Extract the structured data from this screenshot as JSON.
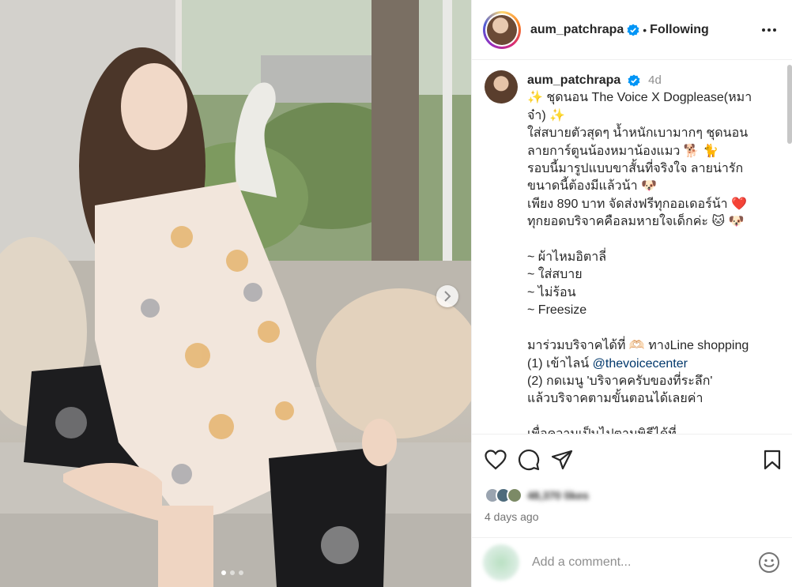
{
  "post": {
    "username": "aum_patchrapa",
    "follow_state": "Following",
    "separator": "•",
    "images": {
      "current_index": 1,
      "total": 3
    }
  },
  "caption": {
    "username": "aum_patchrapa",
    "time": "4d",
    "lines": [
      "✨ ชุดนอน The Voice X Dogplease(หมา",
      "จ๋า) ✨",
      "ใส่สบายตัวสุดๆ น้ำหนักเบามากๆ ชุดนอน",
      "ลายการ์ตูนน้องหมาน้องแมว 🐕 🐈",
      "รอบนี้มารูปแบบขาสั้นที่จริงใจ ลายน่ารัก",
      "ขนาดนี้ต้องมีแล้วน้า 🐶",
      "เพียง 890 บาท จัดส่งฟรีทุกออเดอร์น้า ❤️",
      "ทุกยอดบริจาคคือลมหายใจเด็กค่ะ 🐱 🐶",
      "",
      "~ ผ้าไหมอิตาลี่",
      "~ ใส่สบาย",
      "~ ไม่ร้อน",
      "~ Freesize",
      "",
      "มาร่วมบริจาคได้ที่ 🫶🏻 ทางLine shopping"
    ],
    "line_mention_prefix": "(1) เข้าไลน์ ",
    "mention": "@thevoicecenter",
    "after_lines": [
      "(2) กดเมนู 'บริจาคครับของที่ระลึก'",
      "แล้วบริจาคตามขั้นตอนได้เลยค่า",
      "",
      "เพื่อความเป็นไปตามพิธีได้ที่"
    ]
  },
  "engagement": {
    "likes_text": "48,370 likes",
    "time_ago": "4 days ago"
  },
  "comment_box": {
    "placeholder": "Add a comment..."
  },
  "icons": {
    "verified": "verified-badge-icon",
    "like": "heart-icon",
    "comment": "comment-bubble-icon",
    "share": "paper-plane-icon",
    "save": "bookmark-icon",
    "more": "more-options-icon",
    "emoji": "emoji-icon",
    "next": "chevron-right-icon"
  },
  "colors": {
    "verified": "#0095f6",
    "mention": "#00376b",
    "secondary_text": "#737373"
  }
}
